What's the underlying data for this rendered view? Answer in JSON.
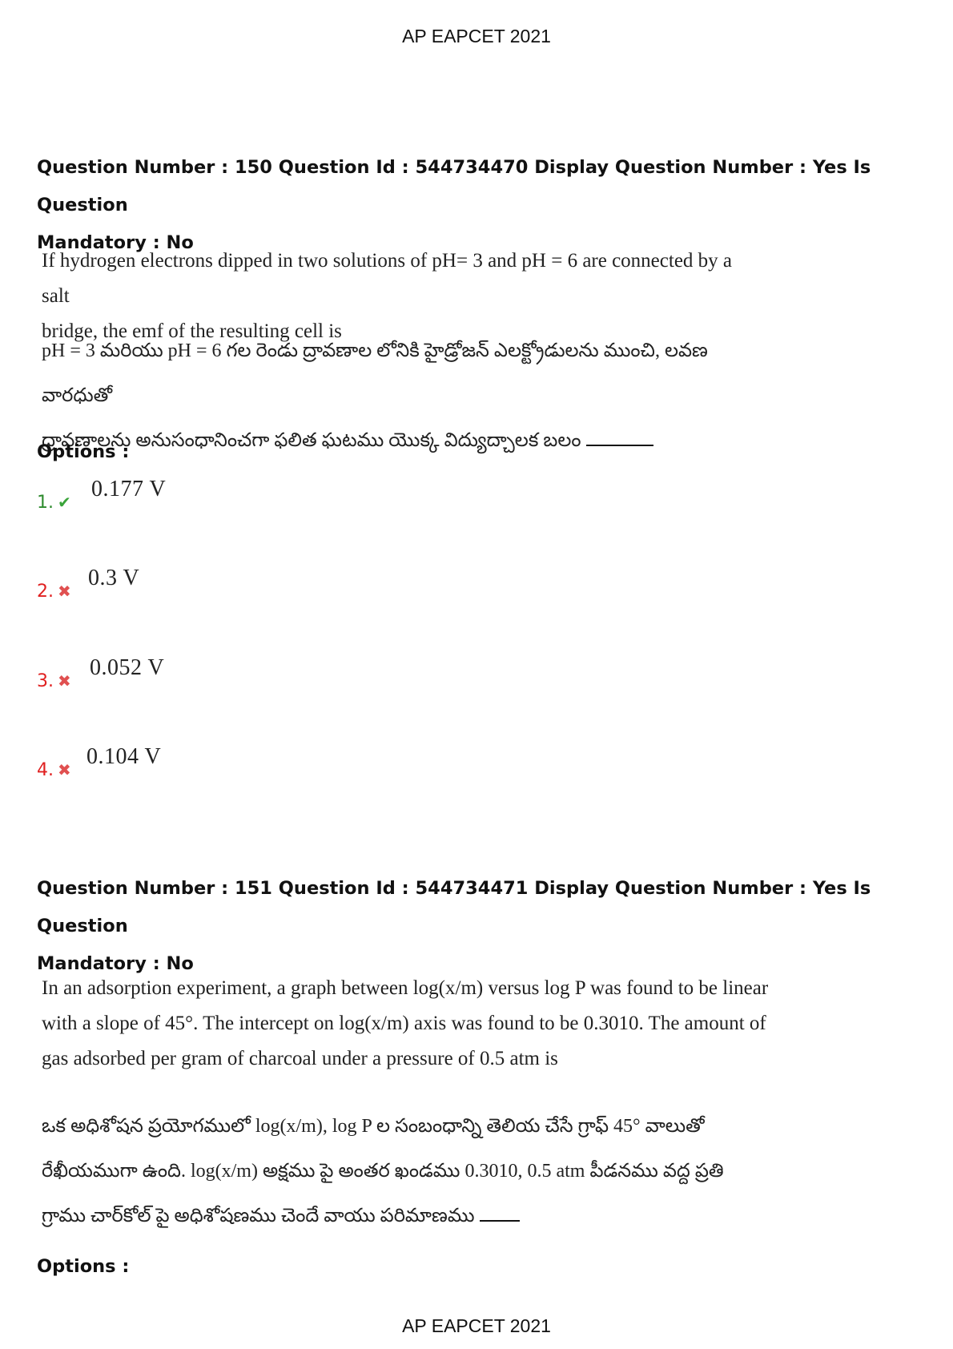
{
  "header": "AP EAPCET 2021",
  "footer": "AP EAPCET 2021",
  "questions": [
    {
      "meta_line1": "Question Number : 150 Question Id : 544734470 Display Question Number : Yes Is Question",
      "meta_line2": "Mandatory : No",
      "text_en_lines": [
        "If hydrogen electrons dipped in two solutions of pH= 3 and pH = 6 are connected by a salt",
        "bridge, the emf of the resulting cell is"
      ],
      "text_te_lines": [
        "pH = 3 మరియు pH = 6 గల రెండు ద్రావణాల లోనికి హైడ్రోజన్ ఎలక్ట్రోడులను ముంచి, లవణ వారధుతో",
        "ద్రావణాలను అనుసంధానించగా ఫలిత ఘటము యొక్క విద్యుద్చాలక బలం"
      ],
      "options_label": "Options :",
      "options": [
        {
          "num": "1.",
          "value": "0.177 V",
          "mark": "✔",
          "status": "correct"
        },
        {
          "num": "2.",
          "value": "0.3 V",
          "mark": "✖",
          "status": "wrong"
        },
        {
          "num": "3.",
          "value": "0.052 V",
          "mark": "✖",
          "status": "wrong"
        },
        {
          "num": "4.",
          "value": "0.104 V",
          "mark": "✖",
          "status": "wrong"
        }
      ]
    },
    {
      "meta_line1": "Question Number : 151 Question Id : 544734471 Display Question Number : Yes Is Question",
      "meta_line2": "Mandatory : No",
      "text_en_lines": [
        "In an adsorption experiment, a graph between log(x/m) versus log P was found to be linear",
        "with a slope of 45°. The intercept on log(x/m) axis was found to be 0.3010. The amount of",
        "gas adsorbed per gram of charcoal under a pressure of 0.5 atm is"
      ],
      "text_te_lines": [
        "ఒక అధిశోషన ప్రయోగములో log(x/m), log P ల సంబంధాన్ని తెలియ చేసే గ్రాఫ్ 45° వాలుతో",
        "రేఖీయముగా ఉంది. log(x/m) అక్షము పై అంతర ఖండము 0.3010, 0.5 atm పీడనము వద్ద ప్రతి",
        "గ్రాము చార్‌కోల్ పై అధిశోషణము చెందే వాయు పరిమాణము"
      ],
      "options_label": "Options :"
    }
  ]
}
